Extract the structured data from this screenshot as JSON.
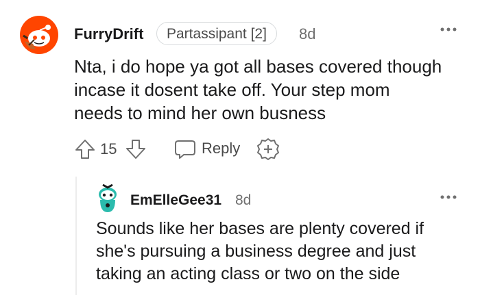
{
  "comment": {
    "avatar_icon": "snoo-avatar-icon",
    "username": "FurryDrift",
    "flair": "Partassipant [2]",
    "time": "8d",
    "body_lines": [
      "Nta, i do hope ya got all bases covered though",
      "incase it dosent take off. Your step mom",
      "needs to mind her own busness"
    ],
    "vote_count": "15",
    "reply_label": "Reply",
    "colors": {
      "accent_orange": "#ff4500",
      "text": "#1a1a1b",
      "meta": "#6f6f6f"
    }
  },
  "reply": {
    "avatar_icon": "snoo-avatar-icon",
    "username": "EmElleGee31",
    "time": "8d",
    "body_lines": [
      "Sounds like her bases are plenty covered if",
      "she's pursuing a business degree and just",
      "taking an acting class or two on the side"
    ],
    "colors": {
      "avatar_teal": "#2bbbad"
    }
  }
}
